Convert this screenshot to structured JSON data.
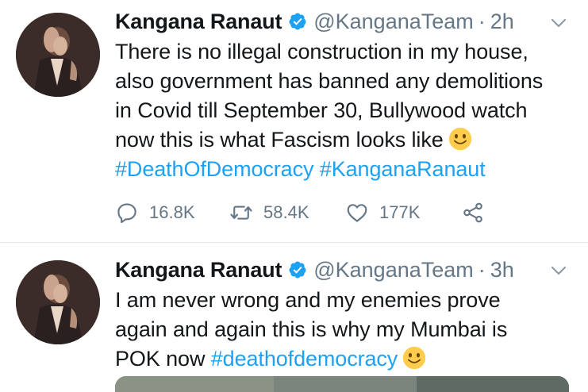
{
  "tweets": [
    {
      "author": {
        "name": "Kangana Ranaut",
        "handle": "@KanganaTeam",
        "verified": true
      },
      "time": "2h",
      "text_lines": [
        "There is no illegal construction in my house,",
        "also government has banned any demolitions",
        "in Covid till September 30, Bullywood watch",
        "now this is what Fascism looks like"
      ],
      "emoji": "slightly-smiling-face",
      "hashtags": [
        "#DeathOfDemocracy",
        "#KanganaRanaut"
      ],
      "stats": {
        "replies": "16.8K",
        "retweets": "58.4K",
        "likes": "177K"
      }
    },
    {
      "author": {
        "name": "Kangana Ranaut",
        "handle": "@KanganaTeam",
        "verified": true
      },
      "time": "3h",
      "text_lines": [
        "I am never wrong and my enemies prove",
        "again and again this is why my Mumbai is",
        "POK now"
      ],
      "hashtags": [
        "#deathofdemocracy"
      ],
      "emoji": "slightly-smiling-face",
      "has_media": true
    }
  ],
  "separator": "·",
  "icons": {
    "reply": "reply-icon",
    "retweet": "retweet-icon",
    "like": "heart-icon",
    "share": "share-icon",
    "verified": "verified-badge-icon",
    "caret": "chevron-down-icon"
  },
  "colors": {
    "text": "#14171a",
    "secondary": "#657786",
    "accent": "#1da1f2",
    "divider": "#e1e8ed"
  }
}
